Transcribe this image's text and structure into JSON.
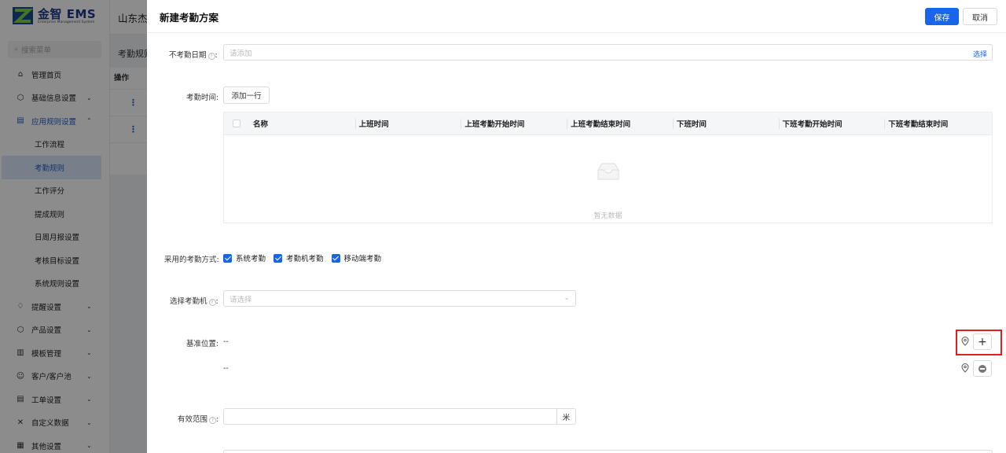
{
  "sidebar": {
    "logo_title": "金智 EMS",
    "logo_subtitle": "Enterprise Management System",
    "search_placeholder": "搜索菜单",
    "items": [
      {
        "label": "管理首页",
        "icon": "home-icon",
        "glyph": "⌂",
        "has_chevron": false
      },
      {
        "label": "基础信息设置",
        "icon": "cube-icon",
        "glyph": "⬡",
        "has_chevron": true,
        "chevron": "⌄"
      },
      {
        "label": "应用规则设置",
        "icon": "document-icon",
        "glyph": "▤",
        "has_chevron": true,
        "chevron": "⌃",
        "open": true
      }
    ],
    "sub_items": [
      {
        "label": "工作流程"
      },
      {
        "label": "考勤规则",
        "active": true
      },
      {
        "label": "工作评分"
      },
      {
        "label": "提成规则"
      },
      {
        "label": "日周月报设置"
      },
      {
        "label": "考核目标设置"
      },
      {
        "label": "系统规则设置"
      }
    ],
    "items_after": [
      {
        "label": "提醒设置",
        "icon": "bell-icon",
        "glyph": "♢"
      },
      {
        "label": "产品设置",
        "icon": "box-icon",
        "glyph": "⬡"
      },
      {
        "label": "模板管理",
        "icon": "template-icon",
        "glyph": "▥"
      },
      {
        "label": "客户/客户池",
        "icon": "customers-icon",
        "glyph": "☺"
      },
      {
        "label": "工单设置",
        "icon": "ticket-icon",
        "glyph": "▤"
      },
      {
        "label": "自定义数据",
        "icon": "tools-icon",
        "glyph": "✕"
      },
      {
        "label": "其他设置",
        "icon": "grid-icon",
        "glyph": "▦"
      }
    ],
    "chevron_down": "⌄"
  },
  "topbar": {
    "company": "山东杰"
  },
  "background": {
    "tab": "考勤规则",
    "table_header": "操作",
    "row_action_glyph": "⋮"
  },
  "drawer": {
    "title": "新建考勤方案",
    "save_label": "保存",
    "cancel_label": "取消",
    "help_glyph": "?",
    "no_attendance": {
      "label": "不考勤日期",
      "placeholder": "请添加",
      "select_link": "选择"
    },
    "attendance_time": {
      "label": "考勤时间:",
      "add_row_label": "添加一行"
    },
    "table": {
      "columns": [
        "名称",
        "上班时间",
        "上班考勤开始时间",
        "上班考勤结束时间",
        "下班时间",
        "下班考勤开始时间",
        "下班考勤结束时间"
      ],
      "empty_text": "暂无数据"
    },
    "methods": {
      "label": "采用的考勤方式:",
      "options": [
        {
          "label": "系统考勤",
          "checked": true
        },
        {
          "label": "考勤机考勤",
          "checked": true
        },
        {
          "label": "移动端考勤",
          "checked": true
        }
      ]
    },
    "machine": {
      "label": "选择考勤机",
      "placeholder": "请选择",
      "arrow_glyph": "⌄"
    },
    "base_location": {
      "label": "基准位置:",
      "rows": [
        {
          "value": "--"
        },
        {
          "value": "--"
        }
      ],
      "add_glyph": "+"
    },
    "range": {
      "label": "有效范围",
      "value": "",
      "unit": "米"
    }
  }
}
